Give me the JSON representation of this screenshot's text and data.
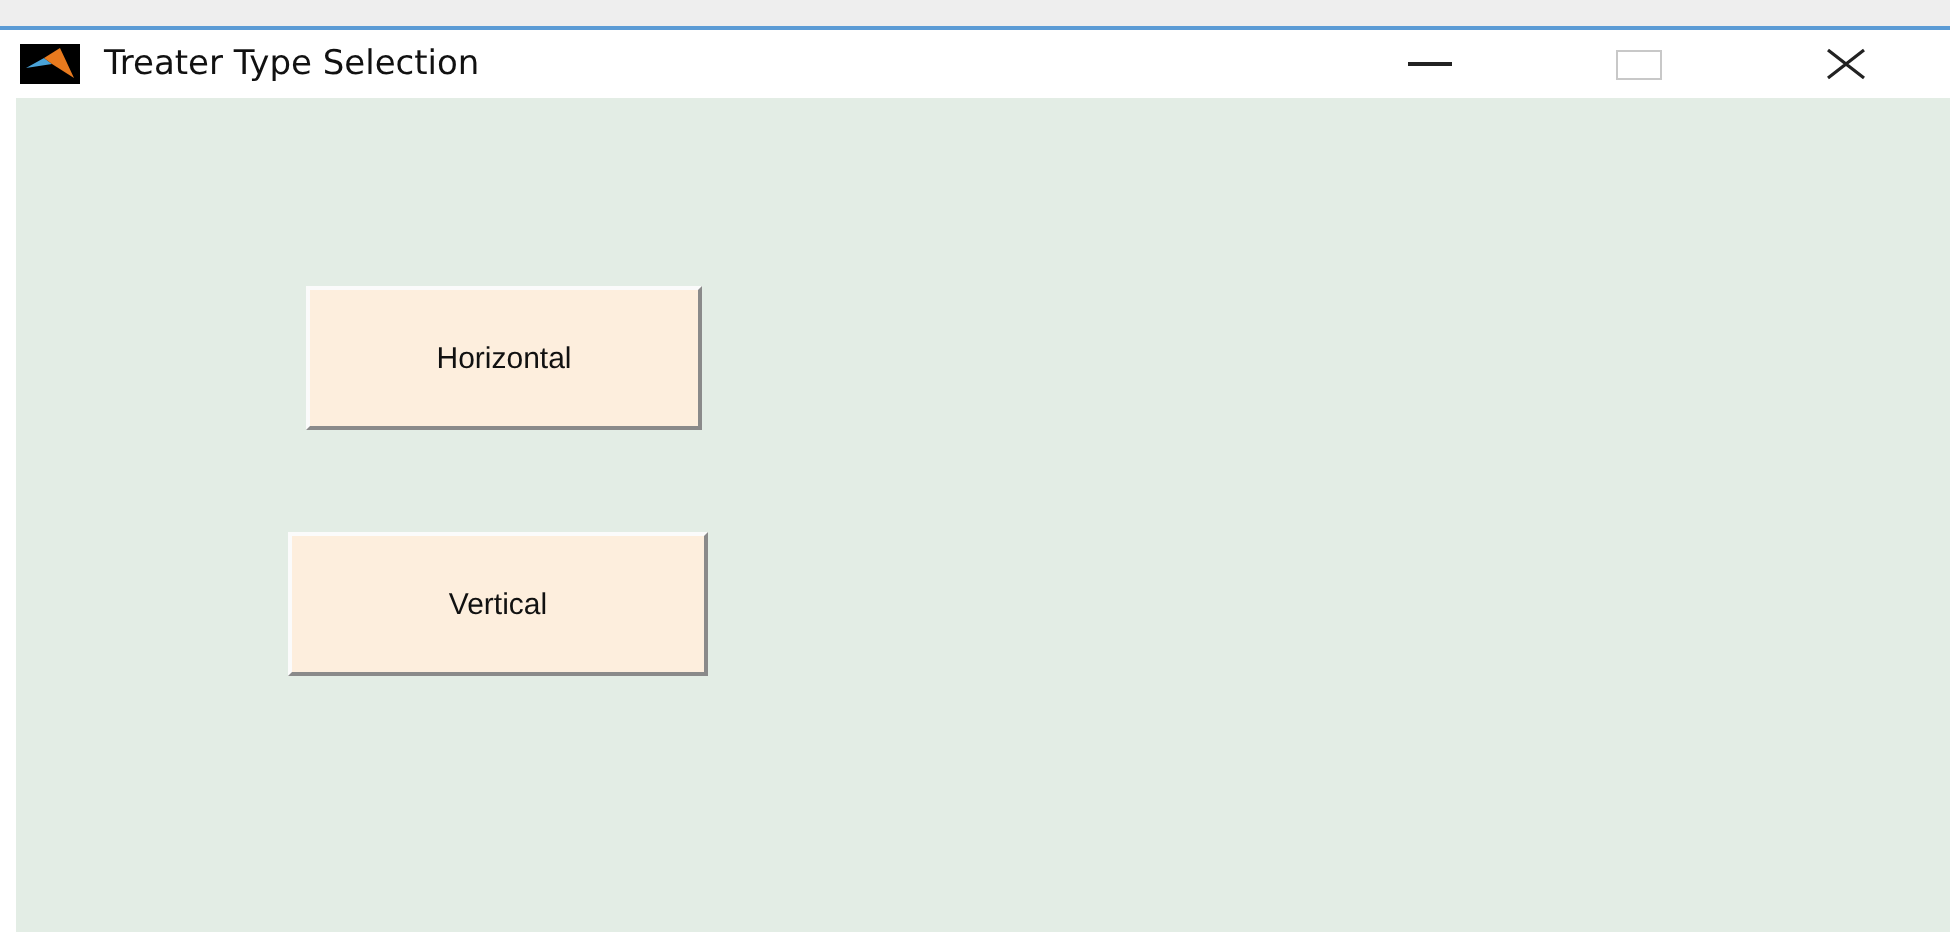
{
  "window": {
    "title": "Treater Type Selection"
  },
  "buttons": [
    {
      "label": "Horizontal"
    },
    {
      "label": "Vertical"
    }
  ]
}
